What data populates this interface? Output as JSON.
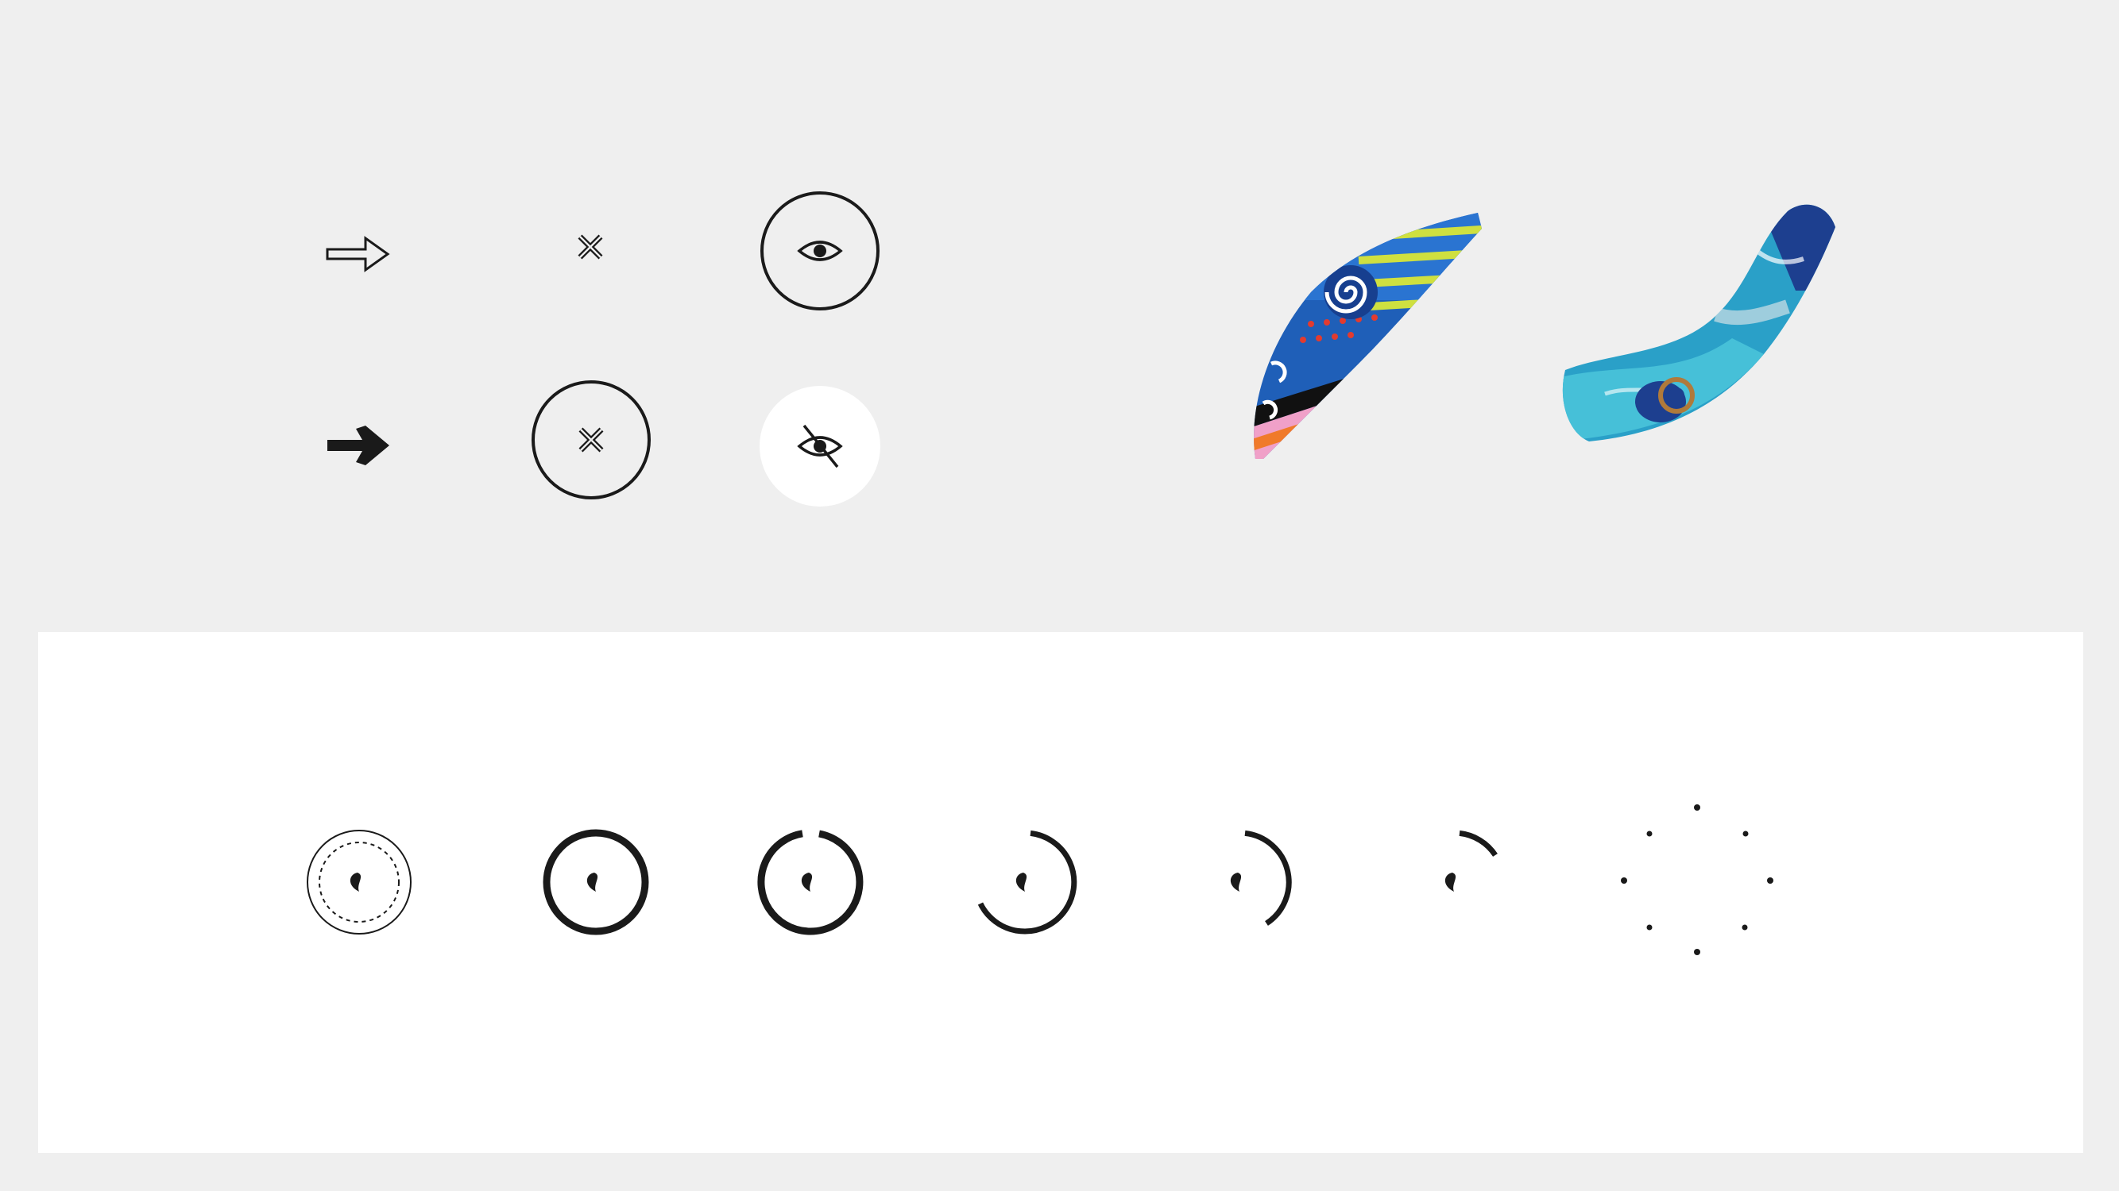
{
  "colors": {
    "background": "#efefef",
    "panel": "#ffffff",
    "ink": "#1a1a1a"
  },
  "icon_set": {
    "row1": [
      "arrow-outline-icon",
      "close-small-icon",
      "eye-circle-outline-icon"
    ],
    "row2": [
      "arrow-solid-icon",
      "close-circle-outline-icon",
      "eye-off-circle-filled-icon"
    ]
  },
  "brush_strokes": [
    "patterned-brush-stroke",
    "blue-brush-stroke"
  ],
  "loader_states": [
    {
      "name": "loader-idle",
      "progress": 0
    },
    {
      "name": "loader-full",
      "progress": 1.0
    },
    {
      "name": "loader-step-1",
      "progress": 0.95
    },
    {
      "name": "loader-step-2",
      "progress": 0.6
    },
    {
      "name": "loader-step-3",
      "progress": 0.35
    },
    {
      "name": "loader-step-4",
      "progress": 0.15
    },
    {
      "name": "loader-dots",
      "progress": 0
    }
  ]
}
